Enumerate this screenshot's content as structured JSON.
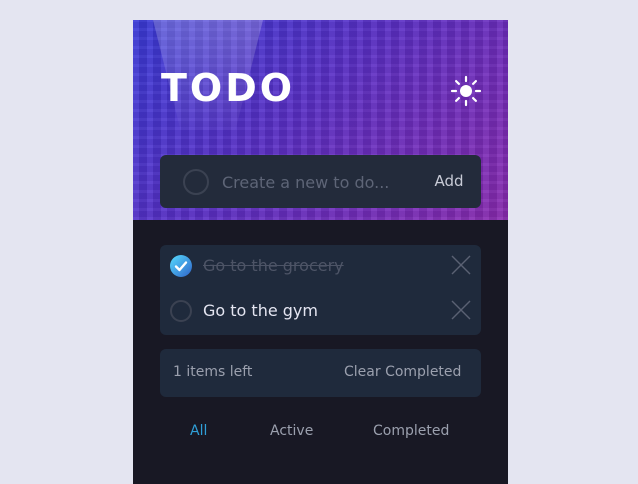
{
  "header": {
    "title": "TODO"
  },
  "create": {
    "placeholder": "Create a new to do...",
    "add_label": "Add"
  },
  "todos": [
    {
      "text": "Go to the grocery",
      "completed": true
    },
    {
      "text": "Go to the gym",
      "completed": false
    }
  ],
  "footer": {
    "items_left": "1 items left",
    "clear_label": "Clear Completed"
  },
  "filters": {
    "all": "All",
    "active": "Active",
    "completed": "Completed",
    "selected": "All"
  },
  "icons": {
    "theme_toggle": "sun-icon",
    "delete": "close-icon",
    "check": "check-icon"
  },
  "colors": {
    "accent": "#3a7bfd",
    "filter_active": "#2f9fd8",
    "check_gradient_start": "#57ddff",
    "check_gradient_end": "#2f63c8"
  }
}
